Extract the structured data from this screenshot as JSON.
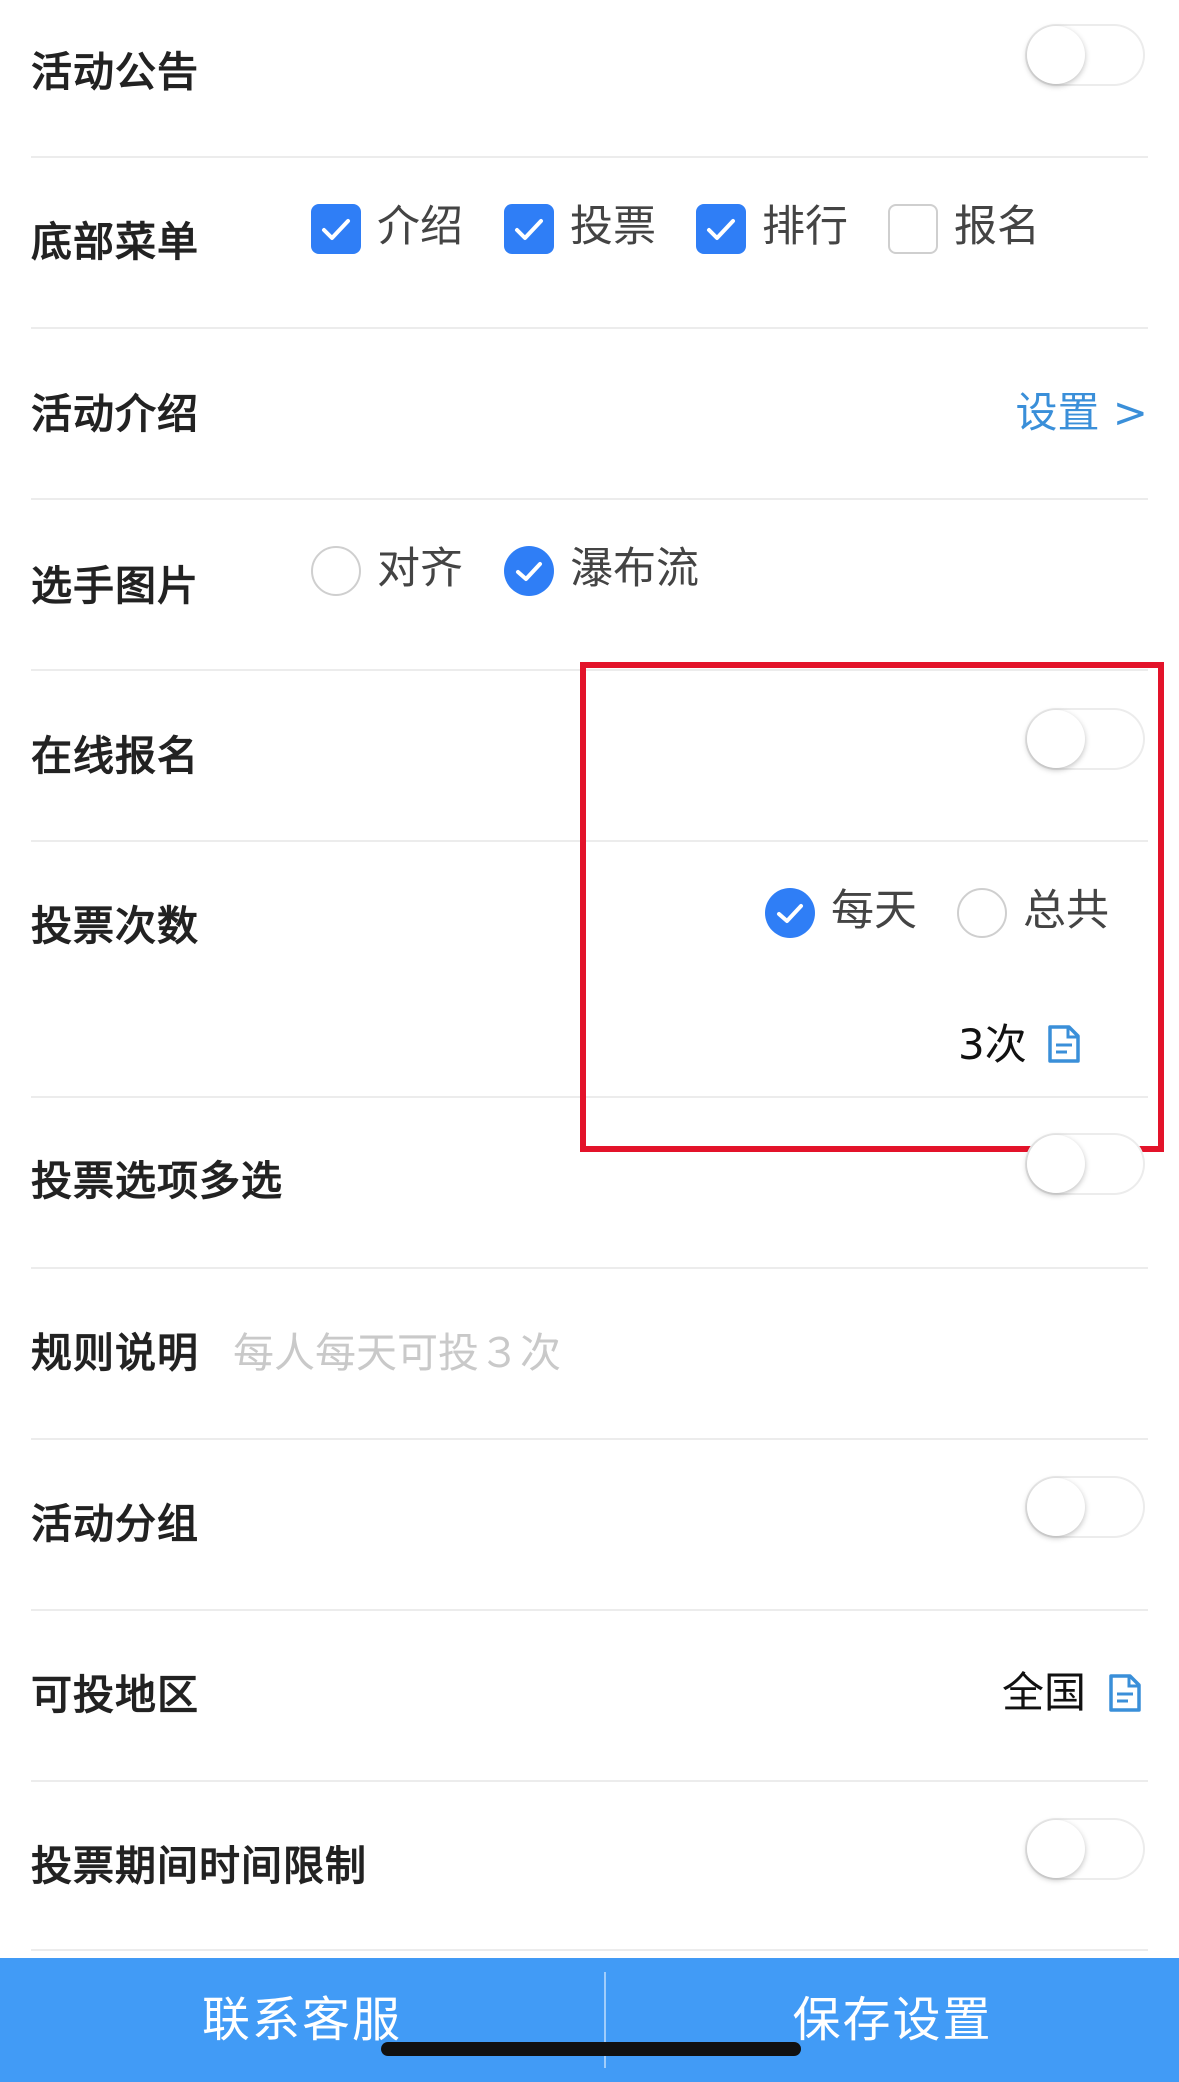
{
  "settings": {
    "announcement": {
      "label": "活动公告",
      "enabled": false
    },
    "bottom_menu": {
      "label": "底部菜单",
      "options": [
        {
          "label": "介绍",
          "checked": true
        },
        {
          "label": "投票",
          "checked": true
        },
        {
          "label": "排行",
          "checked": true
        },
        {
          "label": "报名",
          "checked": false
        }
      ]
    },
    "intro": {
      "label": "活动介绍",
      "link": "设置 >"
    },
    "player_image": {
      "label": "选手图片",
      "options": [
        {
          "label": "对齐",
          "selected": false
        },
        {
          "label": "瀑布流",
          "selected": true
        }
      ]
    },
    "online_signup": {
      "label": "在线报名",
      "enabled": false
    },
    "vote_count": {
      "label": "投票次数",
      "options": [
        {
          "label": "每天",
          "selected": true
        },
        {
          "label": "总共",
          "selected": false
        }
      ],
      "value": "3次"
    },
    "multi_select": {
      "label": "投票选项多选",
      "enabled": false
    },
    "rules": {
      "label": "规则说明",
      "placeholder": "每人每天可投３次"
    },
    "grouping": {
      "label": "活动分组",
      "enabled": false
    },
    "region": {
      "label": "可投地区",
      "value": "全国"
    },
    "time_limit": {
      "label": "投票期间时间限制",
      "enabled": false
    }
  },
  "footer": {
    "contact_label": "联系客服",
    "save_label": "保存设置"
  },
  "colors": {
    "accent": "#2f7ef6",
    "link": "#3a8fd9",
    "bar": "#419bf6",
    "highlight": "#e3132a"
  }
}
